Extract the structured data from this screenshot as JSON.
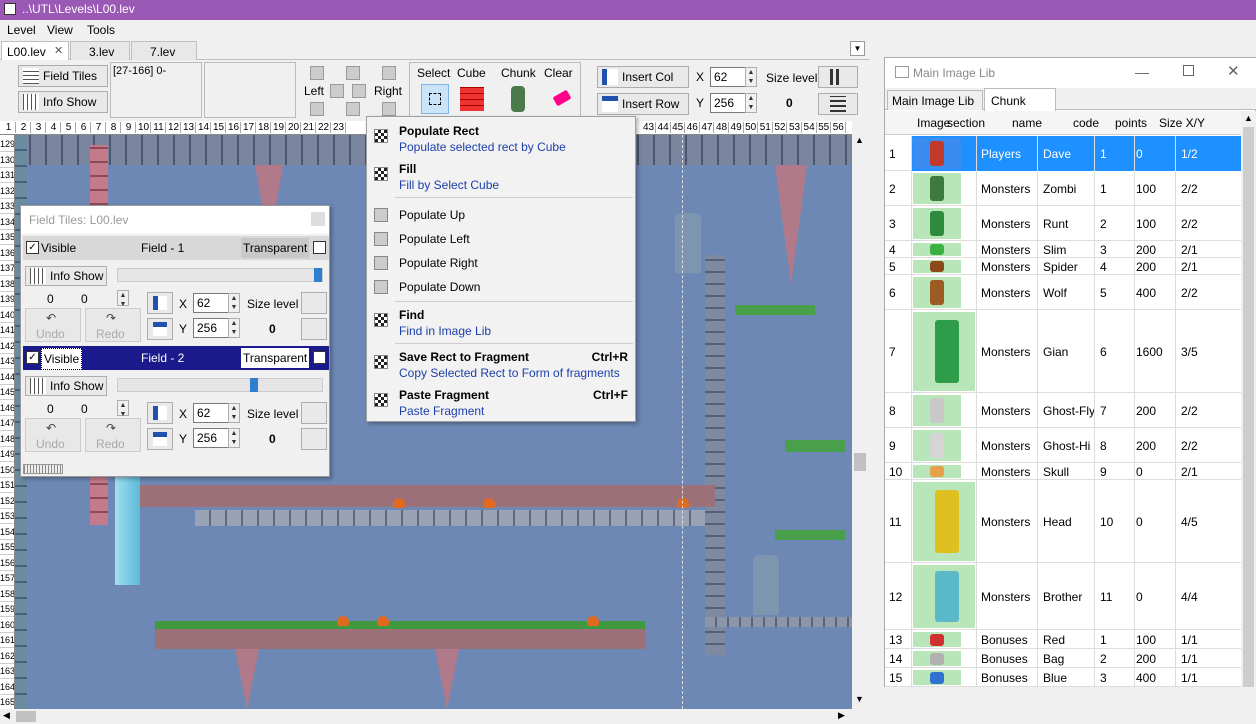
{
  "window": {
    "title": "..\\UTL\\Levels\\L00.lev",
    "title_bg": "#9b59b6"
  },
  "menu": [
    "Level",
    "View",
    "Tools"
  ],
  "tabs": [
    "L00.lev",
    "3.lev",
    "7.lev"
  ],
  "toolbar": {
    "field_tiles": "Field Tiles",
    "info_show": "Info Show",
    "coords": "[27-166] 0-",
    "left": "Left",
    "right": "Right",
    "select": "Select",
    "cube": "Cube",
    "chunk": "Chunk",
    "clear": "Clear",
    "insert_col": "Insert Col",
    "insert_row": "Insert Row",
    "x_label": "X",
    "y_label": "Y",
    "x_value": "62",
    "y_value": "256",
    "size_level": "Size level",
    "size_value": "0"
  },
  "ruler": {
    "cols": [
      "1",
      "2",
      "3",
      "4",
      "5",
      "6",
      "7",
      "8",
      "9",
      "10",
      "11",
      "12",
      "13",
      "14",
      "15",
      "16",
      "17",
      "18",
      "19",
      "20",
      "21",
      "22",
      "23",
      "43",
      "44",
      "45",
      "46",
      "47",
      "48",
      "49",
      "50",
      "51",
      "52",
      "53",
      "54",
      "55",
      "56"
    ],
    "rows": [
      "129",
      "130",
      "131",
      "132",
      "133",
      "134",
      "135",
      "136",
      "137",
      "138",
      "139",
      "140",
      "141",
      "142",
      "143",
      "144",
      "145",
      "146",
      "147",
      "148",
      "149",
      "150",
      "151",
      "152",
      "153",
      "154",
      "155",
      "156",
      "157",
      "158",
      "159",
      "160",
      "161",
      "162",
      "163",
      "164",
      "165"
    ]
  },
  "field_tiles": {
    "title": "Field Tiles: L00.lev",
    "fields": [
      {
        "visible": "Visible",
        "name": "Field - 1",
        "transparent": "Transparent",
        "info": "Info Show",
        "a": "0",
        "b": "0",
        "undo": "Undo",
        "redo": "Redo",
        "x_label": "X",
        "y_label": "Y",
        "x": "62",
        "y": "256",
        "size_level": "Size level",
        "size": "0"
      },
      {
        "visible": "Visible",
        "name": "Field - 2",
        "transparent": "Transparent",
        "info": "Info Show",
        "a": "0",
        "b": "0",
        "undo": "Undo",
        "redo": "Redo",
        "x_label": "X",
        "y_label": "Y",
        "x": "62",
        "y": "256",
        "size_level": "Size level",
        "size": "0"
      }
    ]
  },
  "context_menu": [
    {
      "title": "Populate Rect",
      "sub": "Populate selected rect by Cube",
      "shortcut": ""
    },
    {
      "title": "Fill",
      "sub": "Fill by Select Cube",
      "shortcut": ""
    },
    {
      "title": "Populate Up",
      "sub": "",
      "shortcut": ""
    },
    {
      "title": "Populate Left",
      "sub": "",
      "shortcut": ""
    },
    {
      "title": "Populate Right",
      "sub": "",
      "shortcut": ""
    },
    {
      "title": "Populate Down",
      "sub": "",
      "shortcut": ""
    },
    {
      "title": "Find",
      "sub": "Find in Image Lib",
      "shortcut": ""
    },
    {
      "title": "Save Rect to Fragment",
      "sub": "Copy Selected Rect to Form of fragments",
      "shortcut": "Ctrl+R"
    },
    {
      "title": "Paste Fragment",
      "sub": "Paste Fragment",
      "shortcut": "Ctrl+F"
    }
  ],
  "image_lib": {
    "title": "Main Image Lib",
    "tabs": [
      "Main Image Lib",
      "Chunk"
    ],
    "headers": [
      "Image",
      "section",
      "name",
      "code",
      "points",
      "Size X/Y"
    ],
    "rows": [
      {
        "n": "1",
        "section": "Players",
        "name": "Dave",
        "code": "1",
        "points": "0",
        "size": "1/2",
        "color": "#c0392b"
      },
      {
        "n": "2",
        "section": "Monsters",
        "name": "Zombi",
        "code": "1",
        "points": "100",
        "size": "2/2",
        "color": "#3d7a3d"
      },
      {
        "n": "3",
        "section": "Monsters",
        "name": "Runt",
        "code": "2",
        "points": "100",
        "size": "2/2",
        "color": "#2e8b3e"
      },
      {
        "n": "4",
        "section": "Monsters",
        "name": "Slim",
        "code": "3",
        "points": "200",
        "size": "2/1",
        "color": "#3cb043"
      },
      {
        "n": "5",
        "section": "Monsters",
        "name": "Spider",
        "code": "4",
        "points": "200",
        "size": "2/1",
        "color": "#8b4a1c"
      },
      {
        "n": "6",
        "section": "Monsters",
        "name": "Wolf",
        "code": "5",
        "points": "400",
        "size": "2/2",
        "color": "#9b5b22"
      },
      {
        "n": "7",
        "section": "Monsters",
        "name": "Gian",
        "code": "6",
        "points": "1600",
        "size": "3/5",
        "color": "#2f9c4a"
      },
      {
        "n": "8",
        "section": "Monsters",
        "name": "Ghost-Fly",
        "code": "7",
        "points": "200",
        "size": "2/2",
        "color": "#c8c8c8"
      },
      {
        "n": "9",
        "section": "Monsters",
        "name": "Ghost-Hi",
        "code": "8",
        "points": "200",
        "size": "2/2",
        "color": "#d5d5d5"
      },
      {
        "n": "10",
        "section": "Monsters",
        "name": "Skull",
        "code": "9",
        "points": "0",
        "size": "2/1",
        "color": "#e6a04a"
      },
      {
        "n": "11",
        "section": "Monsters",
        "name": "Head",
        "code": "10",
        "points": "0",
        "size": "4/5",
        "color": "#e0c020"
      },
      {
        "n": "12",
        "section": "Monsters",
        "name": "Brother",
        "code": "11",
        "points": "0",
        "size": "4/4",
        "color": "#5bb8c8"
      },
      {
        "n": "13",
        "section": "Bonuses",
        "name": "Red",
        "code": "1",
        "points": "100",
        "size": "1/1",
        "color": "#d03030"
      },
      {
        "n": "14",
        "section": "Bonuses",
        "name": "Bag",
        "code": "2",
        "points": "200",
        "size": "1/1",
        "color": "#b0b0b0"
      },
      {
        "n": "15",
        "section": "Bonuses",
        "name": "Blue",
        "code": "3",
        "points": "400",
        "size": "1/1",
        "color": "#3070d0"
      }
    ]
  }
}
